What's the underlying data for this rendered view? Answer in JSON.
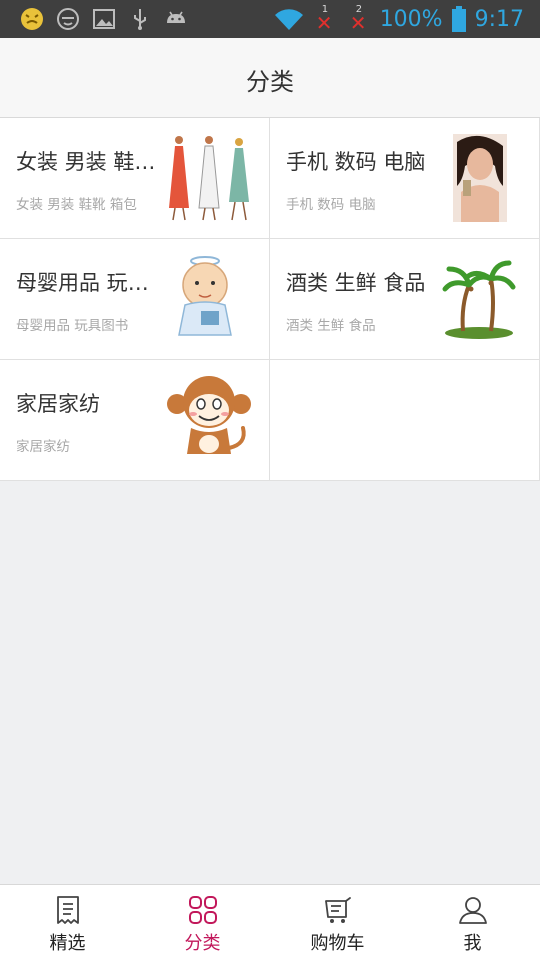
{
  "status_bar": {
    "sim1": "1",
    "sim2": "2",
    "battery": "100%",
    "time": "9:17",
    "icons": [
      "emoji-icon",
      "face-icon",
      "image-icon",
      "usb-icon",
      "android-icon",
      "wifi-icon",
      "sim-x-icon",
      "battery-icon"
    ]
  },
  "header": {
    "title": "分类"
  },
  "categories": [
    {
      "title": "女装 男装 鞋靴 箱包",
      "subtitle": "女装 男装 鞋靴 箱包",
      "image": "fashion-sketch"
    },
    {
      "title": "手机 数码 电脑",
      "subtitle": "手机 数码 电脑",
      "image": "model-portrait"
    },
    {
      "title": "母婴用品 玩具图书",
      "subtitle": "母婴用品 玩具图书",
      "image": "baby-cartoon"
    },
    {
      "title": "酒类 生鲜 食品",
      "subtitle": "酒类 生鲜 食品",
      "image": "palm-island"
    },
    {
      "title": "家居家纺",
      "subtitle": "家居家纺",
      "image": "monkey-cartoon"
    }
  ],
  "bottom_nav": {
    "items": [
      {
        "label": "精选",
        "icon": "document-icon",
        "active": false
      },
      {
        "label": "分类",
        "icon": "grid-icon",
        "active": true
      },
      {
        "label": "购物车",
        "icon": "cart-icon",
        "active": false
      },
      {
        "label": "我",
        "icon": "person-icon",
        "active": false
      }
    ]
  },
  "colors": {
    "accent": "#c2185b",
    "statusbar": "#3f3f3f",
    "status_text": "#2fa7e0"
  }
}
